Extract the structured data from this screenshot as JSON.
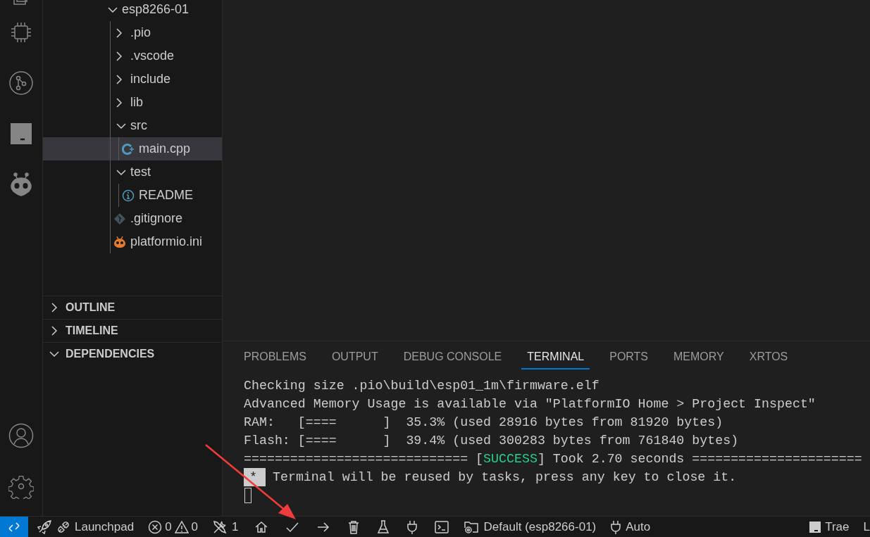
{
  "explorer": {
    "tree": [
      {
        "label": "esp8266-01",
        "kind": "folder",
        "expanded": true,
        "selected": false,
        "children": [
          {
            "label": ".pio",
            "kind": "folder",
            "expanded": false,
            "selected": false
          },
          {
            "label": ".vscode",
            "kind": "folder",
            "expanded": false,
            "selected": false
          },
          {
            "label": "include",
            "kind": "folder",
            "expanded": false,
            "selected": false
          },
          {
            "label": "lib",
            "kind": "folder",
            "expanded": false,
            "selected": false
          },
          {
            "label": "src",
            "kind": "folder",
            "expanded": true,
            "selected": false,
            "children": [
              {
                "label": "main.cpp",
                "kind": "cpp",
                "selected": true
              }
            ]
          },
          {
            "label": "test",
            "kind": "folder",
            "expanded": true,
            "selected": false,
            "children": [
              {
                "label": "README",
                "kind": "readme",
                "selected": false
              }
            ]
          },
          {
            "label": ".gitignore",
            "kind": "gitignore",
            "selected": false
          },
          {
            "label": "platformio.ini",
            "kind": "ini",
            "selected": false
          }
        ]
      }
    ],
    "sections": [
      {
        "label": "OUTLINE",
        "expanded": false
      },
      {
        "label": "TIMELINE",
        "expanded": false
      },
      {
        "label": "DEPENDENCIES",
        "expanded": true
      }
    ]
  },
  "panel": {
    "tabs": [
      {
        "label": "PROBLEMS",
        "selected": false
      },
      {
        "label": "OUTPUT",
        "selected": false
      },
      {
        "label": "DEBUG CONSOLE",
        "selected": false
      },
      {
        "label": "TERMINAL",
        "selected": true
      },
      {
        "label": "PORTS",
        "selected": false
      },
      {
        "label": "MEMORY",
        "selected": false
      },
      {
        "label": "XRTOS",
        "selected": false
      }
    ],
    "terminal": [
      {
        "kind": "text",
        "text": "Checking size .pio\\build\\esp01_1m\\firmware.elf"
      },
      {
        "kind": "text",
        "text": "Advanced Memory Usage is available via \"PlatformIO Home > Project Inspect\""
      },
      {
        "kind": "text",
        "text": "RAM:   [====      ]  35.3% (used 28916 bytes from 81920 bytes)"
      },
      {
        "kind": "text",
        "text": "Flash: [====      ]  39.4% (used 300283 bytes from 761840 bytes)"
      },
      {
        "kind": "result",
        "before": "============================= [",
        "status": "SUCCESS",
        "after": "] Took 2.70 seconds ======================"
      },
      {
        "kind": "notice",
        "mark": "*",
        "text": "Terminal will be reused by tasks, press any key to close it."
      },
      {
        "kind": "cursor"
      }
    ]
  },
  "status_bar": {
    "items": [
      {
        "kind": "remote"
      },
      {
        "kind": "launchpad",
        "text": "Launchpad"
      },
      {
        "kind": "problems",
        "errors": "0",
        "warnings": "0"
      },
      {
        "kind": "tools",
        "text": "1"
      },
      {
        "kind": "home"
      },
      {
        "kind": "build"
      },
      {
        "kind": "upload"
      },
      {
        "kind": "clean"
      },
      {
        "kind": "test"
      },
      {
        "kind": "monitor"
      },
      {
        "kind": "terminal"
      },
      {
        "kind": "env",
        "text": "Default (esp8266-01)"
      },
      {
        "kind": "port",
        "text": "Auto"
      },
      {
        "kind": "spacer"
      },
      {
        "kind": "trae",
        "text": "Trae"
      },
      {
        "kind": "text",
        "text": "L"
      }
    ]
  }
}
